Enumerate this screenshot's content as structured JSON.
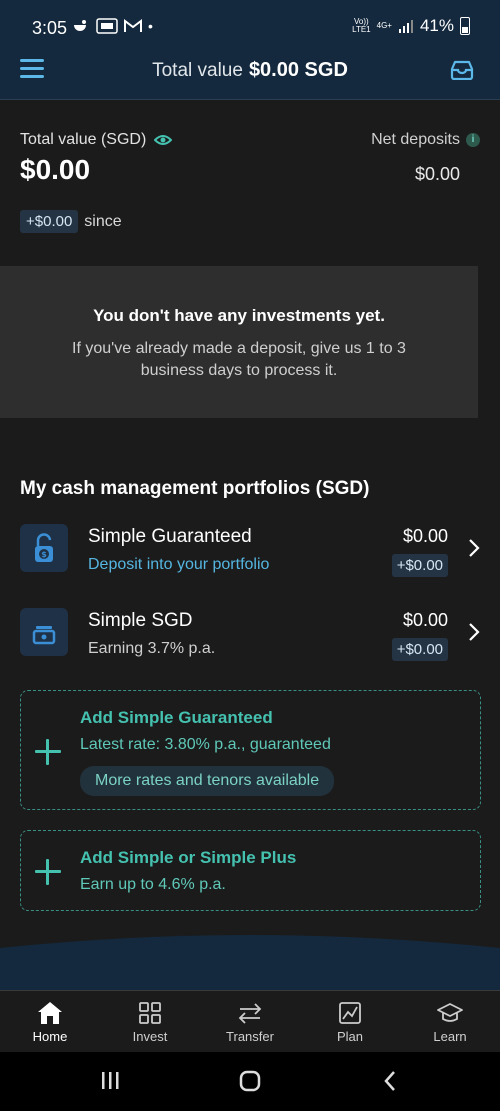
{
  "status_bar": {
    "time": "3:05",
    "battery_percent": "41%",
    "network_top": "Vo))",
    "network_bottom": "LTE1",
    "network_type": "4G+"
  },
  "header": {
    "title_label": "Total value",
    "title_value": "$0.00 SGD"
  },
  "summary": {
    "total_value_label": "Total value (SGD)",
    "total_value": "$0.00",
    "net_deposits_label": "Net deposits",
    "net_deposits_value": "$0.00",
    "change_chip": "+$0.00",
    "since_text": "since"
  },
  "empty_state": {
    "title": "You don't have any investments yet.",
    "description": "If you've already made a deposit, give us 1 to 3 business days to process it."
  },
  "cash_section": {
    "title": "My cash management portfolios (SGD)",
    "portfolios": [
      {
        "name": "Simple Guaranteed",
        "subtitle": "Deposit into your portfolio",
        "value": "$0.00",
        "change": "+$0.00"
      },
      {
        "name": "Simple SGD",
        "subtitle": "Earning 3.7% p.a.",
        "value": "$0.00",
        "change": "+$0.00"
      }
    ],
    "add_cards": [
      {
        "title": "Add Simple Guaranteed",
        "subtitle": "Latest rate: 3.80% p.a., guaranteed",
        "pill": "More rates and tenors available"
      },
      {
        "title": "Add Simple or Simple Plus",
        "subtitle": "Earn up to 4.6% p.a."
      }
    ]
  },
  "bottom_nav": {
    "items": [
      {
        "label": "Home",
        "icon": "home-icon",
        "active": true
      },
      {
        "label": "Invest",
        "icon": "grid-icon"
      },
      {
        "label": "Transfer",
        "icon": "transfer-icon"
      },
      {
        "label": "Plan",
        "icon": "plan-chart-icon"
      },
      {
        "label": "Learn",
        "icon": "graduation-cap-icon"
      }
    ]
  },
  "colors": {
    "header_bg": "#14293d",
    "accent_teal": "#45c1b0",
    "link_blue": "#55b6e0",
    "background": "#1b1b1b"
  }
}
